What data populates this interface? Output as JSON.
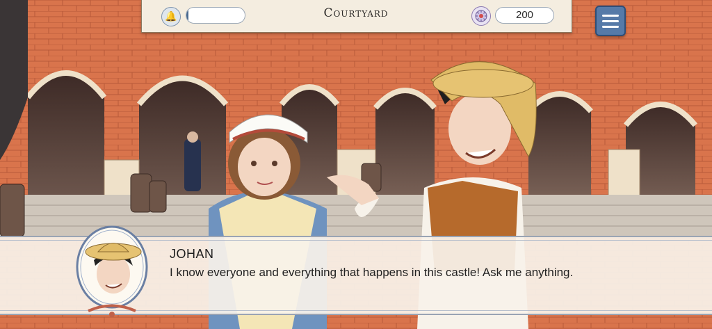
{
  "hud": {
    "location": "Courtyard",
    "coins": "200",
    "energy_fraction": 0.03,
    "icons": {
      "energy": "bell-icon",
      "currency": "coin-icon",
      "menu": "hamburger-menu-icon"
    }
  },
  "dialogue": {
    "speaker": "JOHAN",
    "text": "I know everyone and everything that happens in this castle! Ask me anything."
  },
  "colors": {
    "accent": "#567aa8",
    "panel": "#f4ede0",
    "brick": "#d6764e"
  }
}
